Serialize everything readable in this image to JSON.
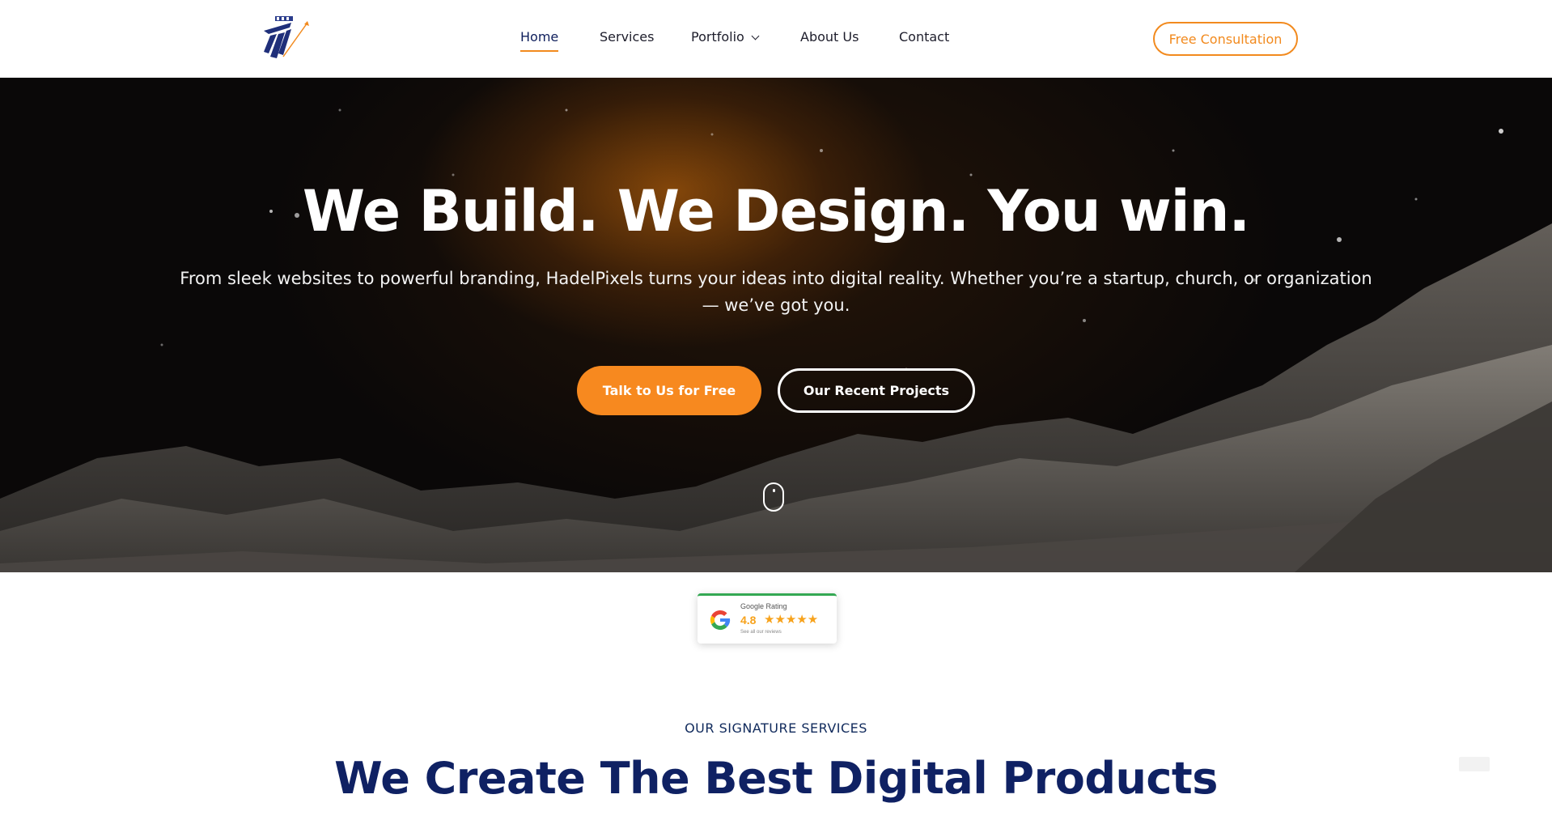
{
  "header": {
    "nav": [
      {
        "label": "Home",
        "active": true
      },
      {
        "label": "Services",
        "active": false
      },
      {
        "label": "Portfolio",
        "active": false,
        "has_dropdown": true
      },
      {
        "label": "About Us",
        "active": false
      },
      {
        "label": "Contact",
        "active": false
      }
    ],
    "cta_label": "Free Consultation",
    "logo_icon": "hadelpixels-logo-icon"
  },
  "hero": {
    "title": "We Build. We Design. You win.",
    "subtitle": "From sleek websites to powerful branding, HadelPixels turns your ideas into digital reality. Whether you’re a startup, church, or organization — we’ve got you.",
    "primary_button": "Talk to Us for Free",
    "secondary_button": "Our Recent Projects",
    "scroll_icon": "mouse-scroll-icon"
  },
  "rating_badge": {
    "label": "Google Rating",
    "score": "4.8",
    "stars": 5,
    "stars_text": "★★★★★",
    "link_text": "See all our reviews"
  },
  "services": {
    "eyebrow": "OUR SIGNATURE SERVICES",
    "title": "We Create The Best Digital Products"
  },
  "colors": {
    "accent": "#f7891f",
    "navy": "#0f2163",
    "google_green": "#34a853"
  }
}
